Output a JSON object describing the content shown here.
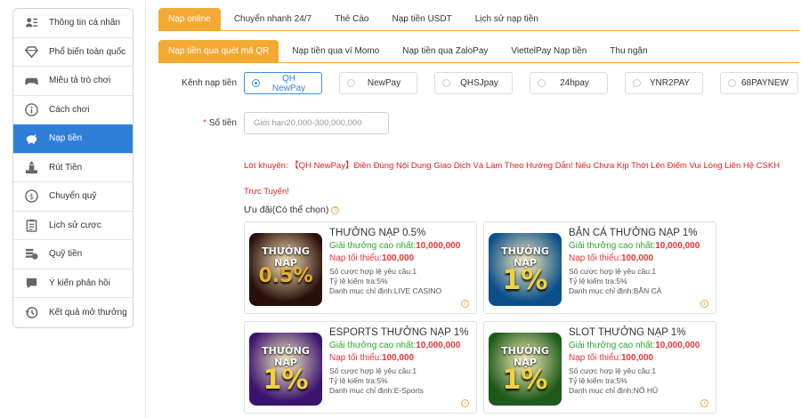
{
  "sidebar": {
    "items": [
      {
        "label": "Thông tin cá nhân",
        "icon": "profile-icon",
        "active": false
      },
      {
        "label": "Phổ biến toàn quốc",
        "icon": "diamond-icon",
        "active": false
      },
      {
        "label": "Miêu tả trò chơi",
        "icon": "gamepad-icon",
        "active": false
      },
      {
        "label": "Cách chơi",
        "icon": "info-icon",
        "active": false
      },
      {
        "label": "Nạp tiền",
        "icon": "piggy-bank-icon",
        "active": true
      },
      {
        "label": "Rút Tiền",
        "icon": "withdraw-icon",
        "active": false
      },
      {
        "label": "Chuyển quỹ",
        "icon": "dollar-icon",
        "active": false
      },
      {
        "label": "Lịch sử cược",
        "icon": "clipboard-icon",
        "active": false
      },
      {
        "label": "Quỹ tiền",
        "icon": "coins-icon",
        "active": false
      },
      {
        "label": "Ý kiến phản hồi",
        "icon": "feedback-icon",
        "active": false
      },
      {
        "label": "Kết quả mở thưởng",
        "icon": "history-icon",
        "active": false
      }
    ]
  },
  "tabs_main": [
    {
      "label": "Nạp online",
      "active": true
    },
    {
      "label": "Chuyển nhanh 24/7",
      "active": false
    },
    {
      "label": "Thẻ Cào",
      "active": false
    },
    {
      "label": "Nạp tiền USDT",
      "active": false
    },
    {
      "label": "Lịch sử nạp tiền",
      "active": false
    }
  ],
  "tabs_sub": [
    {
      "label": "Nạp tiền qua quét mã QR",
      "active": true
    },
    {
      "label": "Nạp tiền qua ví Momo",
      "active": false
    },
    {
      "label": "Nạp tiền qua ZaloPay",
      "active": false
    },
    {
      "label": "ViettelPay Nạp tiền",
      "active": false
    },
    {
      "label": "Thu ngân",
      "active": false
    }
  ],
  "form": {
    "channel_label": "Kênh nạp tiền",
    "channels": [
      {
        "label": "QH NewPay",
        "selected": true
      },
      {
        "label": "NewPay",
        "selected": false
      },
      {
        "label": "QHSJpay",
        "selected": false
      },
      {
        "label": "24hpay",
        "selected": false
      },
      {
        "label": "YNR2PAY",
        "selected": false
      },
      {
        "label": "68PAYNEW",
        "selected": false
      }
    ],
    "amount_required": "*",
    "amount_label": "Số tiền",
    "amount_placeholder": "Giới hạn20,000-300,000,000",
    "advice": "Lời khuyên: 【QH NewPay】Điền Đúng Nội Dung Giao Dịch Và Làm Theo Hướng Dẫn! Nếu Chưa Kịp Thời Lên Điểm Vui Lòng Liên Hệ CSKH Trực Tuyến!"
  },
  "promotions": {
    "title": "Ưu đãi(Có thể chọn)",
    "cards": [
      {
        "title": "THƯỞNG NẠP 0.5%",
        "max_label": "Giải thưởng cao nhất:",
        "max_value": "10,000,000",
        "min_label": "Nạp tối thiểu:",
        "min_value": "100,000",
        "rollover": "Số cược hợp lệ yêu cầu:1",
        "check": "Tỷ lệ kiểm tra:5%",
        "category": "Danh mục chỉ định:LIVE CASINO",
        "thumb_line1": "THƯỞNG NẠP",
        "thumb_line2": "0.5%",
        "thumb_color": "#2a0f0a",
        "accent": "#e8b030"
      },
      {
        "title": "BẮN CÁ THƯỞNG NẠP 1%",
        "max_label": "Giải thưởng cao nhất:",
        "max_value": "10,000,000",
        "min_label": "Nạp tối thiểu:",
        "min_value": "100,000",
        "rollover": "Số cược hợp lệ yêu cầu:1",
        "check": "Tỷ lệ kiểm tra:5%",
        "category": "Danh mục chỉ định:BẮN CÁ",
        "thumb_line1": "THƯỞNG NẠP",
        "thumb_line2": "1%",
        "thumb_color": "#0b4f8a",
        "accent": "#f2d23a"
      },
      {
        "title": "ESPORTS THƯỞNG NẠP 1%",
        "max_label": "Giải thưởng cao nhất:",
        "max_value": "10,000,000",
        "min_label": "Nạp tối thiểu:",
        "min_value": "100,000",
        "rollover": "Số cược hợp lệ yêu cầu:1",
        "check": "Tỷ lệ kiểm tra:5%",
        "category": "Danh mục chỉ định:E-Sports",
        "thumb_line1": "THƯỞNG NẠP",
        "thumb_line2": "1%",
        "thumb_color": "#3b1470",
        "accent": "#f2d23a"
      },
      {
        "title": "SLOT THƯỞNG NẠP 1%",
        "max_label": "Giải thưởng cao nhất:",
        "max_value": "10,000,000",
        "min_label": "Nạp tối thiểu:",
        "min_value": "100,000",
        "rollover": "Số cược hợp lệ yêu cầu:1",
        "check": "Tỷ lệ kiểm tra:5%",
        "category": "Danh mục chỉ định:NỔ HŨ",
        "thumb_line1": "THƯỞNG NẠP",
        "thumb_line2": "1%",
        "thumb_color": "#1d5a1a",
        "accent": "#f2d23a"
      }
    ]
  },
  "colors": {
    "accent_orange": "#f5a935",
    "active_blue": "#2f7fd9",
    "green": "#2aa82a",
    "red": "#e33333"
  }
}
